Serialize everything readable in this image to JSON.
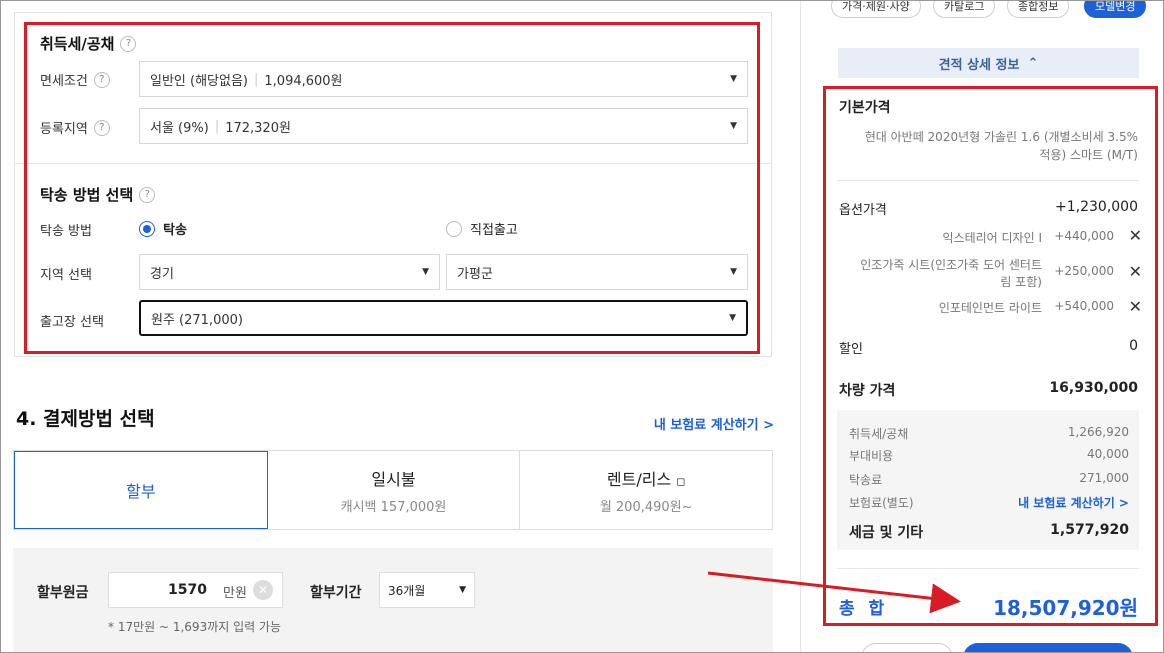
{
  "tax": {
    "title": "취득세/공채",
    "help": "?",
    "exemption_label": "면세조건",
    "exemption_value": "일반인 (해당없음)",
    "exemption_amount": "1,094,600원",
    "region_label": "등록지역",
    "region_value": "서울 (9%)",
    "region_amount": "172,320원"
  },
  "delivery": {
    "title": "탁송 방법 선택",
    "method_label": "탁송 방법",
    "option_delivery": "탁송",
    "option_pickup": "직접출고",
    "area_label": "지역 선택",
    "area_province": "경기",
    "area_city": "가평군",
    "factory_label": "출고장 선택",
    "factory_value": "원주 (271,000)"
  },
  "payment": {
    "title": "4. 결제방법 선택",
    "insurance_link": "내 보험료 계산하기 >",
    "tabs": [
      {
        "label": "할부",
        "sub": ""
      },
      {
        "label": "일시불",
        "sub": "캐시백 157,000원"
      },
      {
        "label": "렌트/리스",
        "sub": "월 200,490원~"
      }
    ],
    "principal_label": "할부원금",
    "principal_value": "1570",
    "principal_unit": "만원",
    "period_label": "할부기간",
    "period_value": "36개월",
    "note": "* 17만원 ~ 1,693까지 입력 가능"
  },
  "right": {
    "chips": [
      "가격·제원·사양",
      "카탈로그",
      "종합정보",
      "모델변경"
    ],
    "detail_toggle": "견적 상세 정보",
    "base_title": "기본가격",
    "base_desc_1": "현대 아반떼 2020년형 가솔린 1.6 (개별소비세 3.5%",
    "base_desc_2": "적용) 스마트 (M/T)",
    "option_label": "옵션가격",
    "option_total": "+1,230,000",
    "options": [
      {
        "name": "익스테리어 디자인 I",
        "price": "+440,000"
      },
      {
        "name_1": "인조가죽 시트(인조가죽 도어 센터트",
        "name_2": "림 포함)",
        "price": "+250,000"
      },
      {
        "name": "인포테인먼트 라이트",
        "price": "+540,000"
      }
    ],
    "discount_label": "할인",
    "discount_value": "0",
    "car_price_label": "차량 가격",
    "car_price_value": "16,930,000",
    "fees": [
      {
        "label": "취득세/공채",
        "value": "1,266,920"
      },
      {
        "label": "부대비용",
        "value": "40,000"
      },
      {
        "label": "탁송료",
        "value": "271,000"
      },
      {
        "label": "보험료(별도)",
        "value": "내 보험료 계산하기 >"
      }
    ],
    "tax_total_label": "세금 및 기타",
    "tax_total_value": "1,577,920",
    "total_label": "총 합",
    "total_value": "18,507,920원"
  },
  "colors": {
    "accent": "#1e60d8",
    "highlight": "#d81b24"
  }
}
